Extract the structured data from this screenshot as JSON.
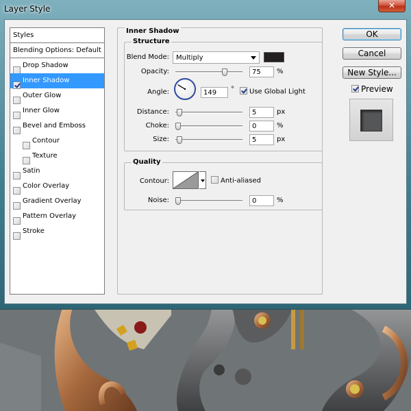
{
  "window": {
    "title": "Layer Style",
    "close_glyph": "✕"
  },
  "styles_panel": {
    "header": "Styles",
    "items": [
      {
        "label": "Blending Options: Default",
        "checkbox": false,
        "checked": false,
        "selected": false,
        "indent": false
      },
      {
        "label": "Drop Shadow",
        "checkbox": true,
        "checked": false,
        "selected": false,
        "indent": false
      },
      {
        "label": "Inner Shadow",
        "checkbox": true,
        "checked": true,
        "selected": true,
        "indent": false
      },
      {
        "label": "Outer Glow",
        "checkbox": true,
        "checked": false,
        "selected": false,
        "indent": false
      },
      {
        "label": "Inner Glow",
        "checkbox": true,
        "checked": false,
        "selected": false,
        "indent": false
      },
      {
        "label": "Bevel and Emboss",
        "checkbox": true,
        "checked": false,
        "selected": false,
        "indent": false
      },
      {
        "label": "Contour",
        "checkbox": true,
        "checked": false,
        "selected": false,
        "indent": true
      },
      {
        "label": "Texture",
        "checkbox": true,
        "checked": false,
        "selected": false,
        "indent": true
      },
      {
        "label": "Satin",
        "checkbox": true,
        "checked": false,
        "selected": false,
        "indent": false
      },
      {
        "label": "Color Overlay",
        "checkbox": true,
        "checked": false,
        "selected": false,
        "indent": false
      },
      {
        "label": "Gradient Overlay",
        "checkbox": true,
        "checked": false,
        "selected": false,
        "indent": false
      },
      {
        "label": "Pattern Overlay",
        "checkbox": true,
        "checked": false,
        "selected": false,
        "indent": false
      },
      {
        "label": "Stroke",
        "checkbox": true,
        "checked": false,
        "selected": false,
        "indent": false
      }
    ]
  },
  "inner_shadow": {
    "title": "Inner Shadow",
    "structure": {
      "title": "Structure",
      "blend_mode_label": "Blend Mode:",
      "blend_mode_value": "Multiply",
      "shadow_color": "#231f20",
      "opacity_label": "Opacity:",
      "opacity_value": "75",
      "opacity_unit": "%",
      "opacity_fraction": 0.75,
      "angle_label": "Angle:",
      "angle_value": "149",
      "angle_unit": "°",
      "angle_degrees": 149,
      "use_global_light_label": "Use Global Light",
      "use_global_light_checked": true,
      "distance_label": "Distance:",
      "distance_value": "5",
      "distance_unit": "px",
      "distance_fraction": 0.02,
      "choke_label": "Choke:",
      "choke_value": "0",
      "choke_unit": "%",
      "choke_fraction": 0.0,
      "size_label": "Size:",
      "size_value": "5",
      "size_unit": "px",
      "size_fraction": 0.02
    },
    "quality": {
      "title": "Quality",
      "contour_label": "Contour:",
      "anti_aliased_label": "Anti-aliased",
      "anti_aliased_checked": false,
      "noise_label": "Noise:",
      "noise_value": "0",
      "noise_unit": "%",
      "noise_fraction": 0.0
    }
  },
  "buttons": {
    "ok": "OK",
    "cancel": "Cancel",
    "new_style": "New Style...",
    "preview_label": "Preview",
    "preview_checked": true
  },
  "colors": {
    "selection": "#3399ff",
    "title_bar": "#5e97a8",
    "preview_swatch": "#555657"
  }
}
